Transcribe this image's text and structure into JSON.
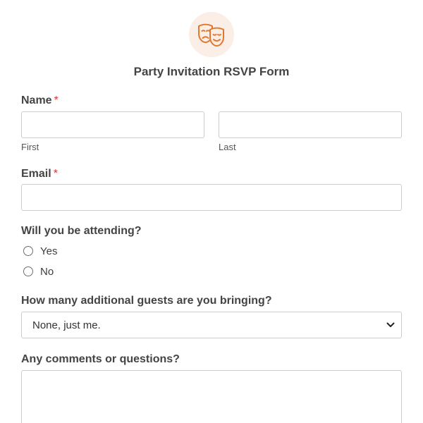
{
  "header": {
    "icon": "theater-masks-icon",
    "title": "Party Invitation RSVP Form"
  },
  "colors": {
    "accent": "#e27730",
    "icon_background": "#fbeee6",
    "required": "#d63637",
    "border": "#cccccc"
  },
  "name_field": {
    "label": "Name",
    "required_mark": "*",
    "first": {
      "value": "",
      "sublabel": "First"
    },
    "last": {
      "value": "",
      "sublabel": "Last"
    }
  },
  "email_field": {
    "label": "Email",
    "required_mark": "*",
    "value": ""
  },
  "attending_field": {
    "label": "Will you be attending?",
    "options": [
      {
        "label": "Yes",
        "checked": false
      },
      {
        "label": "No",
        "checked": false
      }
    ]
  },
  "guests_field": {
    "label": "How many additional guests are you bringing?",
    "selected": "None, just me."
  },
  "comments_field": {
    "label": "Any comments or questions?",
    "value": ""
  }
}
